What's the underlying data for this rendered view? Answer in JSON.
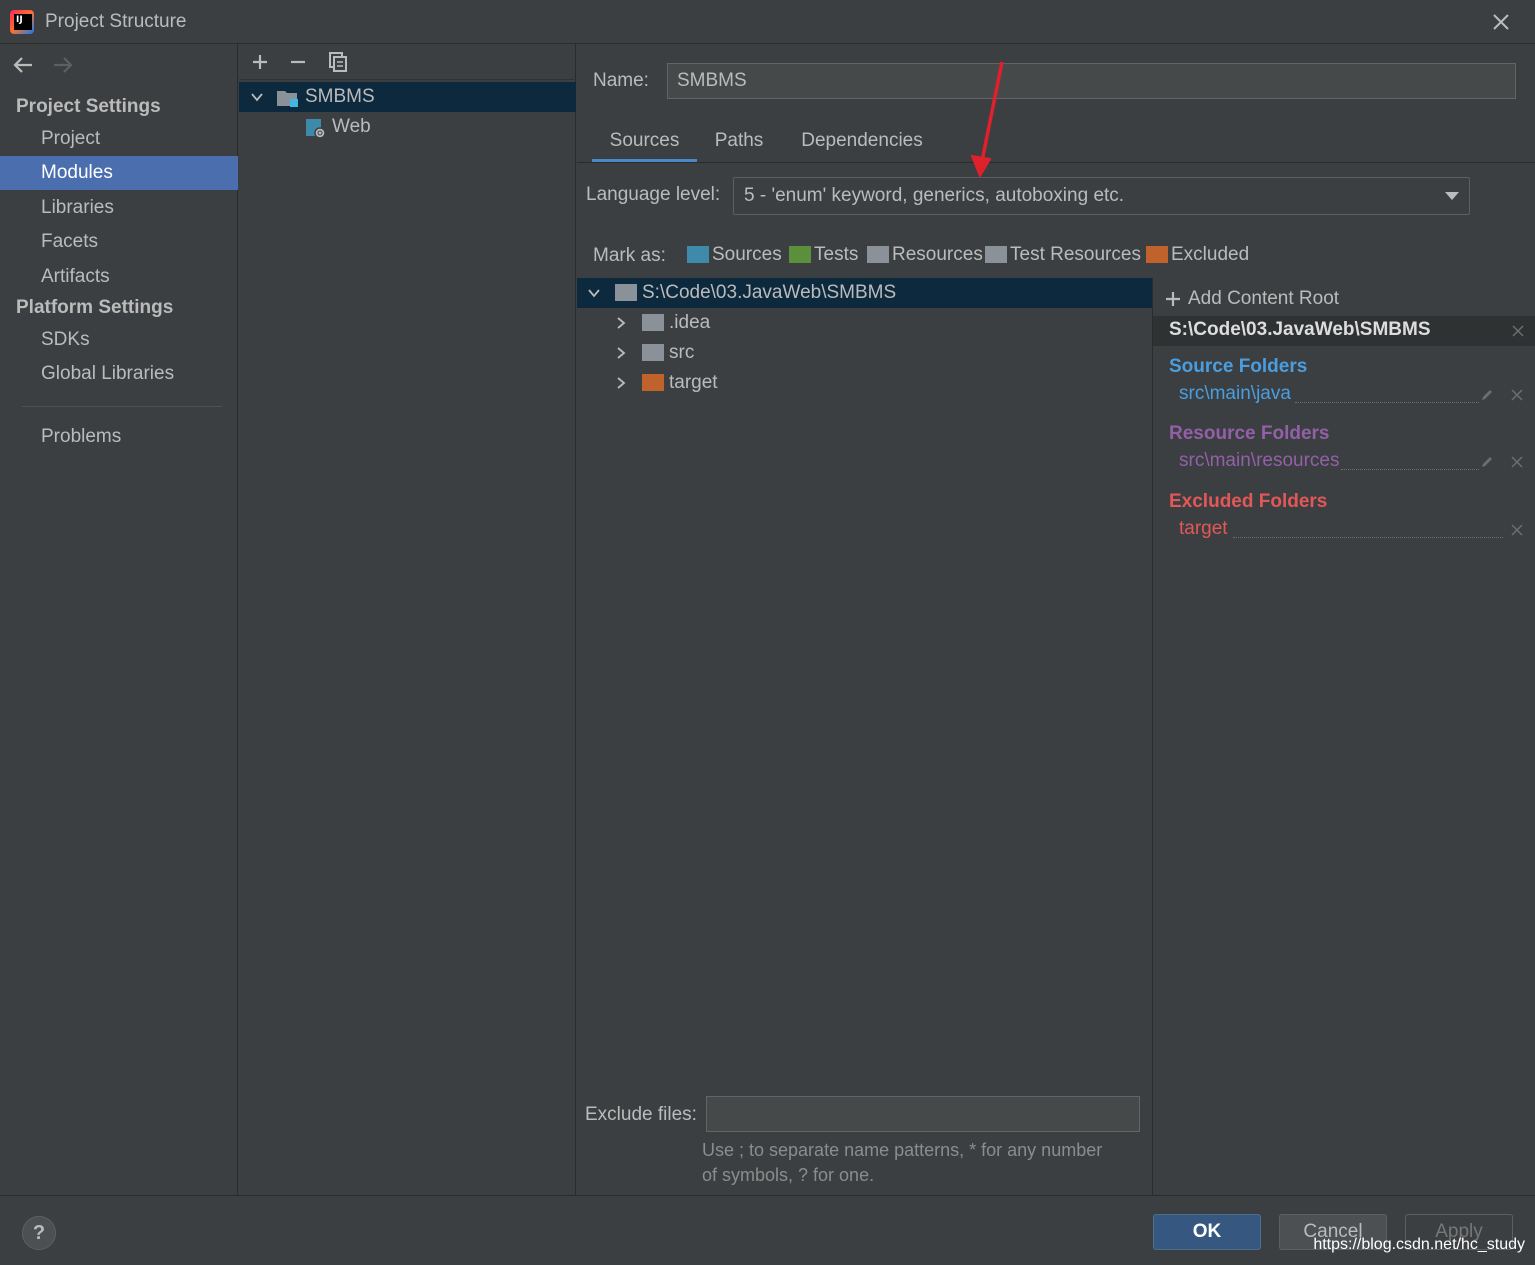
{
  "window": {
    "title": "Project Structure"
  },
  "nav": {
    "project_settings": "Project Settings",
    "platform_settings": "Platform Settings",
    "items_project": [
      "Project",
      "Modules",
      "Libraries",
      "Facets",
      "Artifacts"
    ],
    "items_platform": [
      "SDKs",
      "Global Libraries"
    ],
    "problems": "Problems",
    "selected": "Modules"
  },
  "modules": {
    "tree": [
      {
        "label": "SMBMS",
        "icon": "module-folder-icon",
        "expanded": true
      },
      {
        "label": "Web",
        "icon": "web-facet-icon"
      }
    ]
  },
  "module": {
    "name_label": "Name:",
    "name_value": "SMBMS",
    "tabs": [
      "Sources",
      "Paths",
      "Dependencies"
    ],
    "active_tab": "Sources",
    "language_level_label": "Language level:",
    "language_level_value": "5 - 'enum' keyword, generics, autoboxing etc.",
    "mark_as_label": "Mark as:",
    "mark_as": [
      {
        "label": "Sources",
        "color": "#3d8aab"
      },
      {
        "label": "Tests",
        "color": "#5a8f3c"
      },
      {
        "label": "Resources",
        "color": "#8a9199"
      },
      {
        "label": "Test Resources",
        "color": "#8a9199"
      },
      {
        "label": "Excluded",
        "color": "#c0622b"
      }
    ],
    "content_tree": [
      {
        "label": "S:\\Code\\03.JavaWeb\\SMBMS",
        "color": "#8a9199",
        "expanded": true
      },
      {
        "label": ".idea",
        "color": "#8a9199"
      },
      {
        "label": "src",
        "color": "#8a9199"
      },
      {
        "label": "target",
        "color": "#c0622b"
      }
    ],
    "add_content_root": "Add Content Root",
    "content_root_path": "S:\\Code\\03.JavaWeb\\SMBMS",
    "source_folders": {
      "title": "Source Folders",
      "entry": "src\\main\\java",
      "color": "#4a9ee0"
    },
    "resource_folders": {
      "title": "Resource Folders",
      "entry": "src\\main\\resources",
      "color": "#9360a8"
    },
    "excluded_folders": {
      "title": "Excluded Folders",
      "entry": "target",
      "color": "#e35757"
    },
    "exclude_files_label": "Exclude files:",
    "exclude_files_value": "",
    "exclude_hint_line1": "Use ; to separate name patterns, * for any number",
    "exclude_hint_line2": "of symbols, ? for one."
  },
  "buttons": {
    "help": "?",
    "ok": "OK",
    "cancel": "Cancel",
    "apply": "Apply"
  },
  "watermark": "https://blog.csdn.net/hc_study"
}
